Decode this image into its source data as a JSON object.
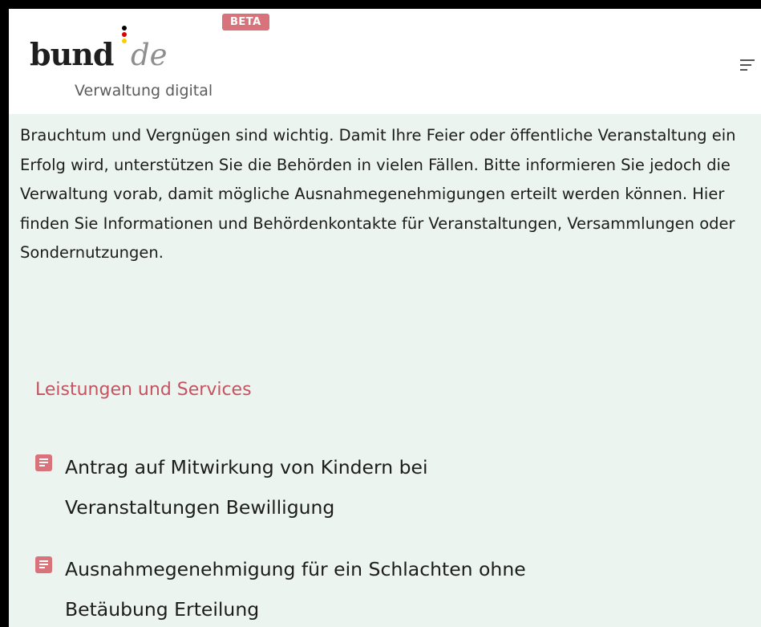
{
  "header": {
    "beta_label": "BETA",
    "logo": {
      "word": "bund",
      "suffix": "de",
      "subtitle": "Verwaltung digital"
    },
    "menu_icon": "hamburger-menu-icon"
  },
  "intro": {
    "text": "Brauchtum und Vergnügen sind wichtig. Damit Ihre Feier oder öffentliche Veranstaltung ein Erfolg wird, unterstützen Sie die Behörden in vielen Fällen. Bitte informieren Sie jedoch die Verwaltung vorab, damit mögliche Ausnahmegenehmigungen erteilt werden können. Hier finden Sie Informationen und Behördenkontakte für Veranstaltungen, Versammlungen oder Sondernutzungen."
  },
  "services": {
    "title": "Leistungen und Services",
    "items": [
      {
        "label": "Antrag auf Mitwirkung von Kindern bei Veranstaltungen Bewilligung",
        "icon": "document-icon"
      },
      {
        "label": "Ausnahmegenehmigung für ein Schlachten ohne Betäubung Erteilung",
        "icon": "document-icon"
      }
    ]
  },
  "colors": {
    "accent": "#d9737b",
    "section_title": "#c6525f",
    "background": "#ecf4f0",
    "logo_dot_black": "#000000",
    "logo_dot_red": "#dd0000",
    "logo_dot_gold": "#ffcc00"
  }
}
